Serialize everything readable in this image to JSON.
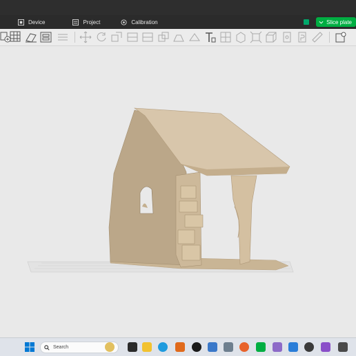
{
  "tabs": [
    {
      "label": "Device",
      "icon": "device-icon"
    },
    {
      "label": "Project",
      "icon": "project-icon"
    },
    {
      "label": "Calibration",
      "icon": "calibration-icon"
    }
  ],
  "slice_button": {
    "label": "Slice plate"
  },
  "taskbar": {
    "search_placeholder": "Search"
  },
  "toolbar_icons": [
    "add-object-icon",
    "arrange-grid-icon",
    "auto-orient-icon",
    "plate-layout-icon",
    "split-icon",
    "move-icon",
    "rotate-icon",
    "scale-icon",
    "cut-icon",
    "boolean-icon",
    "support-paint-icon",
    "seam-paint-icon",
    "text-icon",
    "mesh-repair-icon",
    "object-view-icon",
    "assembly-icon",
    "variable-layer-icon",
    "measure-icon",
    "ruler-icon",
    "settings-icon"
  ],
  "colors": {
    "accent": "#00ae42",
    "model": "#d8c6ab",
    "dark_bar": "#2b2b2b"
  }
}
